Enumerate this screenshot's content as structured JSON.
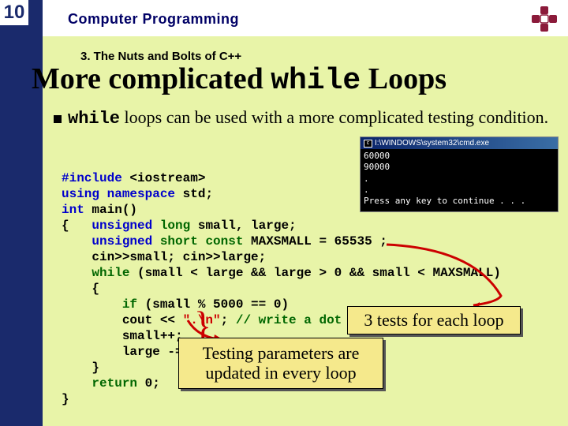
{
  "page_number": "10",
  "header": "Computer Programming",
  "chapter": "3. The Nuts and Bolts of C++",
  "title_pre": "More complicated ",
  "title_code": "while",
  "title_post": " Loops",
  "bullet": {
    "code": "while",
    "rest": " loops can be used with a more complicated testing condition."
  },
  "code": {
    "l1a": "#include",
    "l1b": " <iostream>",
    "l2a": "using namespace",
    "l2b": " std;",
    "l3a": "int",
    "l3b": " main()",
    "l4a": "{   ",
    "l4b": "unsigned ",
    "l4c": "long",
    "l4d": " small, large;",
    "l5a": "    ",
    "l5b": "unsigned ",
    "l5c": "short const",
    "l5d": " MAXSMALL = 65535 ;",
    "l6": "    cin>>small; cin>>large;",
    "l7a": "    ",
    "l7b": "while",
    "l7c": " (small < large && large > 0 && small < MAXSMALL)",
    "l8": "    {",
    "l9a": "        ",
    "l9b": "if",
    "l9c": " (small % 5000 == 0)",
    "l10a": "        cout << ",
    "l10b": "\".\\n\"",
    "l10c": "; ",
    "l10d": "// write a dot every 5000",
    "l11": "        small++;",
    "l12": "        large -= 2;",
    "l13": "    }",
    "l14a": "    ",
    "l14b": "return",
    "l14c": " 0;",
    "l15": "}"
  },
  "callout1": "3 tests for each loop",
  "callout2_a": "Testing parameters are",
  "callout2_b": "updated in every loop",
  "cmd": {
    "title": "I:\\WINDOWS\\system32\\cmd.exe",
    "body": "60000\n90000\n.\n.\nPress any key to continue . . ."
  }
}
